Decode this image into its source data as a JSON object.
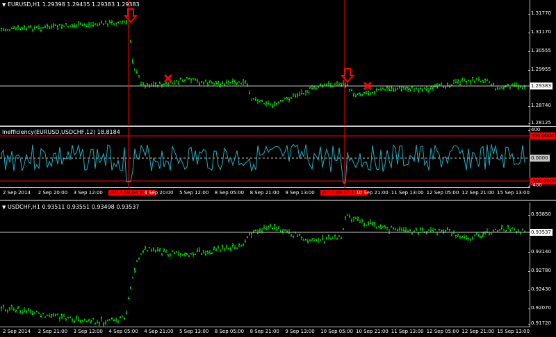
{
  "top_chart": {
    "symbol_label": "EURUSD,H1",
    "ohlc": "1.29398 1.29435 1.29383 1.29383",
    "current_price": "1.29383",
    "price_levels": [
      "1.31770",
      "1.31170",
      "1.30555",
      "1.29955",
      "1.28740",
      "1.28125"
    ]
  },
  "indicator": {
    "label": "Inefficiency(EURUSD,USDCHF,12) 18.8184",
    "levels": [
      "400",
      "-400"
    ],
    "upper_tag": "300.0000",
    "zero_tag": "0.0000",
    "lower_tag": "-300.0000"
  },
  "top_xaxis": {
    "labels": [
      "2 Sep 2014",
      "2 Sep 20:00",
      "3 Sep 12:00",
      "2014.09.04 13:00",
      "4 Sep 20:00",
      "5 Sep 12:00",
      "8 Sep 05:00",
      "8 Sep 21:00",
      "9 Sep 13:00",
      "2014.09.10 13:00",
      "10 Sep 21:00",
      "11 Sep 13:00",
      "12 Sep 05:00",
      "12 Sep 21:00",
      "15 Sep 13:00"
    ],
    "highlight": [
      "2014.09.04 13:00",
      "2014.09.10 13:00"
    ]
  },
  "bottom_chart": {
    "symbol_label": "USDCHF,H1",
    "ohlc": "0.93511 0.93551 0.93498 0.93537",
    "current_price": "0.93537",
    "price_levels": [
      "0.93850",
      "0.93140",
      "0.92780",
      "0.92430",
      "0.92070",
      "0.91720"
    ]
  },
  "bottom_xaxis": {
    "labels": [
      "2 Sep 2014",
      "2 Sep 21:00",
      "3 Sep 13:00",
      "4 Sep 05:00",
      "4 Sep 21:00",
      "5 Sep 13:00",
      "8 Sep 05:00",
      "8 Sep 21:00",
      "9 Sep 13:00",
      "10 Sep 05:00",
      "10 Sep 21:00",
      "11 Sep 13:00",
      "12 Sep 05:00",
      "12 Sep 21:00",
      "15 Sep 13:00"
    ]
  },
  "colors": {
    "candles": "#00ff00",
    "indicator_line": "#20b0c0",
    "marker": "#ff0000",
    "price_line": "#c8c8c8"
  }
}
